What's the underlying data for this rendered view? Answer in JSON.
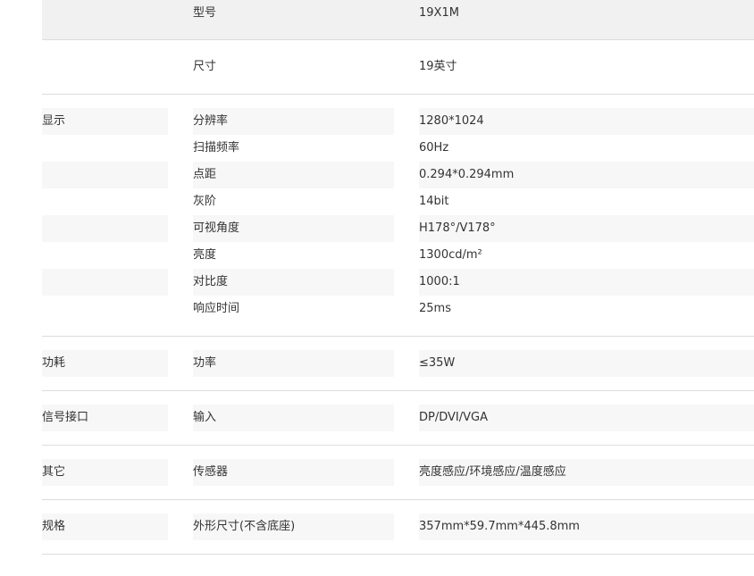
{
  "specs": {
    "groups": [
      {
        "category": "",
        "rows": [
          {
            "name": "型号",
            "value": "19X1M"
          }
        ]
      },
      {
        "category": "",
        "rows": [
          {
            "name": "尺寸",
            "value": "19英寸"
          }
        ]
      },
      {
        "category": "显示",
        "rows": [
          {
            "name": "分辨率",
            "value": "1280*1024"
          },
          {
            "name": "扫描频率",
            "value": "60Hz"
          },
          {
            "name": "点距",
            "value": "0.294*0.294mm"
          },
          {
            "name": "灰阶",
            "value": "14bit"
          },
          {
            "name": "可视角度",
            "value": "H178°/V178°"
          },
          {
            "name": "亮度",
            "value": "1300cd/m²"
          },
          {
            "name": "对比度",
            "value": "1000:1"
          },
          {
            "name": "响应时间",
            "value": "25ms"
          }
        ]
      },
      {
        "category": "功耗",
        "rows": [
          {
            "name": "功率",
            "value": "≤35W"
          }
        ]
      },
      {
        "category": "信号接口",
        "rows": [
          {
            "name": "输入",
            "value": "DP/DVI/VGA"
          }
        ]
      },
      {
        "category": "其它",
        "rows": [
          {
            "name": "传感器",
            "value": "亮度感应/环境感应/温度感应"
          }
        ]
      },
      {
        "category": "规格",
        "rows": [
          {
            "name": "外形尺寸(不含底座)",
            "value": "357mm*59.7mm*445.8mm"
          }
        ]
      }
    ]
  }
}
